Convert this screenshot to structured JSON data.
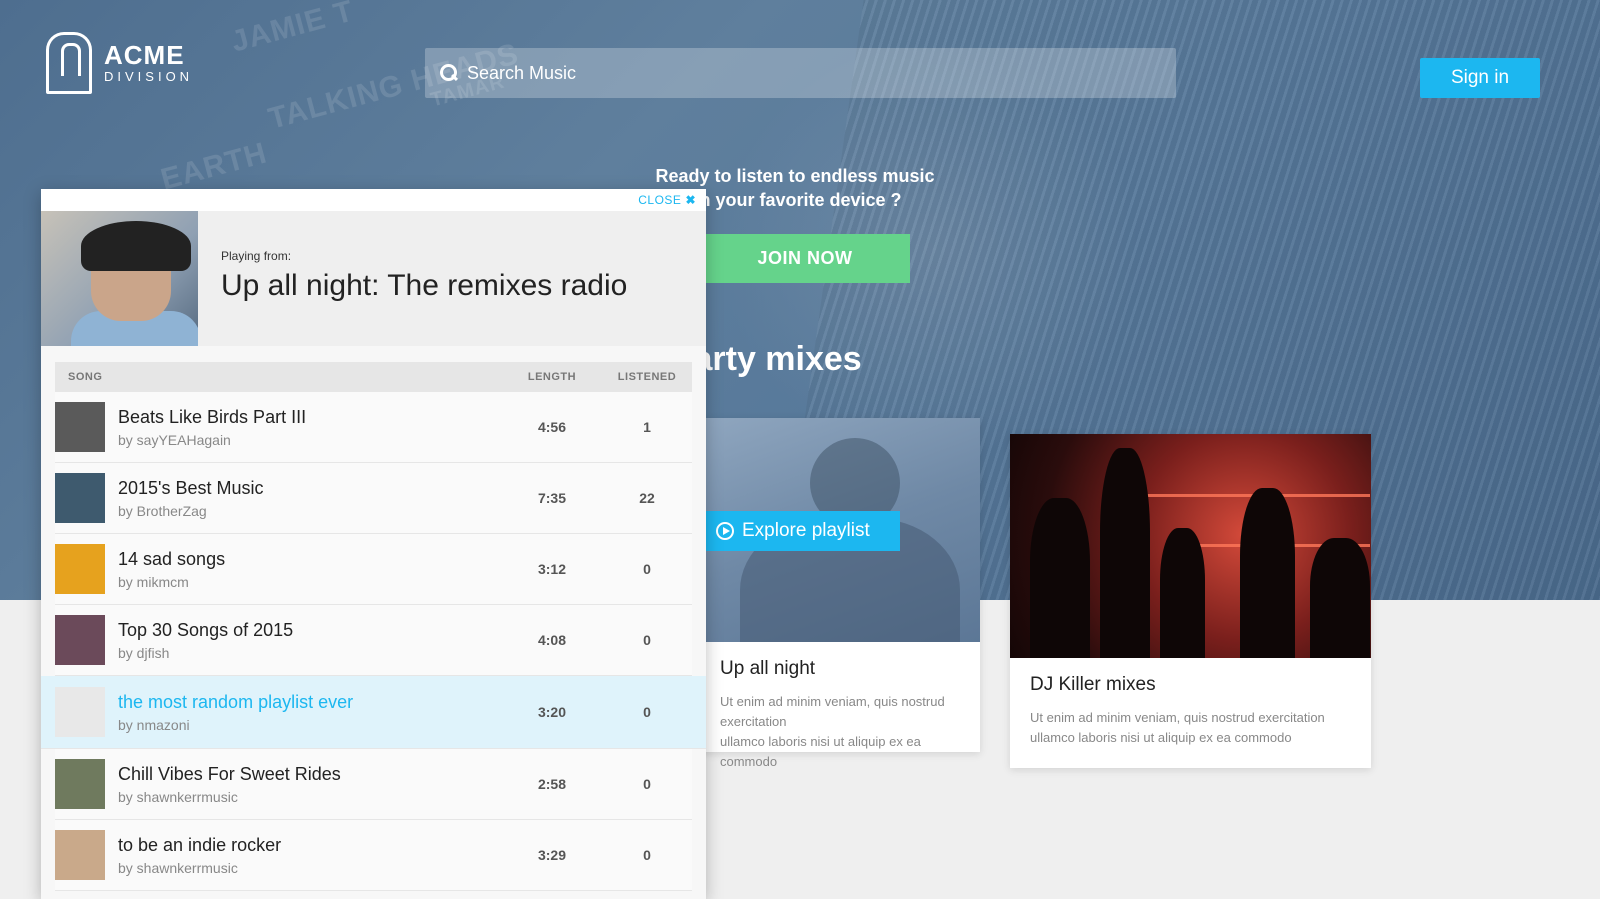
{
  "brand": {
    "title": "ACME",
    "subtitle": "DIVISION"
  },
  "search": {
    "placeholder": "Search Music"
  },
  "header": {
    "signin_label": "Sign in"
  },
  "hero": {
    "cta_line1": "Ready to listen to endless music",
    "cta_line2": "on your favorite device ?",
    "join_label": "JOIN NOW",
    "section_title": "Debauched party mixes",
    "background_words": [
      "JAMIE T",
      "TALKING HEADS",
      "EARTH",
      "TAMAR"
    ]
  },
  "cards": [
    {
      "title": "Up all night",
      "desc_line1": "Ut enim ad minim veniam, quis nostrud exercitation",
      "desc_line2": "ullamco laboris nisi ut aliquip ex ea commodo",
      "explore_label": "Explore playlist"
    },
    {
      "title": "DJ Killer mixes",
      "desc_line1": "Ut enim ad minim veniam, quis nostrud exercitation",
      "desc_line2": "ullamco laboris nisi ut aliquip ex ea commodo"
    }
  ],
  "player": {
    "close_label": "CLOSE",
    "close_icon": "✖",
    "playing_from_label": "Playing from:",
    "station_name": "Up all night: The remixes radio",
    "columns": {
      "song": "SONG",
      "length": "LENGTH",
      "listened": "LISTENED"
    },
    "rows": [
      {
        "title": "Beats Like Birds Part III",
        "by": "by sayYEAHagain",
        "length": "4:56",
        "listened": "1",
        "thumb_color": "#5a5a5a"
      },
      {
        "title": "2015's Best Music",
        "by": "by BrotherZag",
        "length": "7:35",
        "listened": "22",
        "thumb_color": "#3e5a6e"
      },
      {
        "title": "14 sad songs",
        "by": "by mikmcm",
        "length": "3:12",
        "listened": "0",
        "thumb_color": "#e6a21e"
      },
      {
        "title": "Top 30 Songs of 2015",
        "by": "by djfish",
        "length": "4:08",
        "listened": "0",
        "thumb_color": "#6b4a5a"
      },
      {
        "title": "the most random playlist ever",
        "by": "by nmazoni",
        "length": "3:20",
        "listened": "0",
        "thumb_color": "#e8e8e8",
        "active": true
      },
      {
        "title": "Chill Vibes For Sweet Rides",
        "by": "by shawnkerrmusic",
        "length": "2:58",
        "listened": "0",
        "thumb_color": "#6f7a5e"
      },
      {
        "title": "to be an indie rocker",
        "by": "by shawnkerrmusic",
        "length": "3:29",
        "listened": "0",
        "thumb_color": "#c9a98a"
      }
    ]
  },
  "colors": {
    "accent": "#1cb7f0",
    "join": "#65d38b",
    "hero": "#56789a"
  }
}
